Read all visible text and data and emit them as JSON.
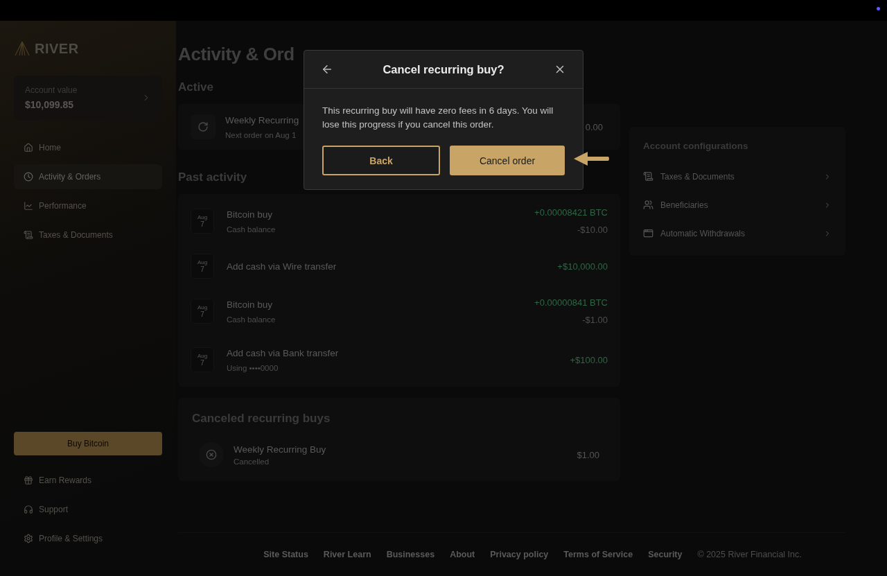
{
  "sidebar": {
    "logo": "RIVER",
    "account": {
      "label": "Account value",
      "value": "$10,099.85"
    },
    "nav": [
      {
        "label": "Home",
        "selected": false
      },
      {
        "label": "Activity & Orders",
        "selected": true
      },
      {
        "label": "Performance",
        "selected": false
      },
      {
        "label": "Taxes & Documents",
        "selected": false
      }
    ],
    "buy_button": "Buy Bitcoin",
    "bottom_nav": [
      {
        "label": "Earn Rewards"
      },
      {
        "label": "Support"
      },
      {
        "label": "Profile & Settings"
      }
    ]
  },
  "page_title": "Activity & Ord",
  "active": {
    "heading": "Active",
    "order": {
      "title": "Weekly Recurring",
      "subtitle": "Next order on Aug 1",
      "amount": "0.00"
    }
  },
  "past": {
    "heading": "Past activity",
    "rows": [
      {
        "month": "Aug",
        "day": "7",
        "title": "Bitcoin buy",
        "subtitle": "Cash balance",
        "amount": "+0.00008421 BTC",
        "amount_2": "-$10.00"
      },
      {
        "month": "Aug",
        "day": "7",
        "title": "Add cash via Wire transfer",
        "amount": "+$10,000.00"
      },
      {
        "month": "Aug",
        "day": "7",
        "title": "Bitcoin buy",
        "subtitle": "Cash balance",
        "amount": "+0.00000841 BTC",
        "amount_2": "-$1.00"
      },
      {
        "month": "Aug",
        "day": "7",
        "title": "Add cash via Bank transfer",
        "subtitle": "Using ••••0000",
        "amount": "+$100.00"
      }
    ]
  },
  "canceled": {
    "heading": "Canceled recurring buys",
    "item": {
      "title": "Weekly Recurring Buy",
      "status": "Cancelled",
      "amount": "$1.00"
    }
  },
  "account_configurations": {
    "title": "Account configurations",
    "items": [
      {
        "label": "Taxes & Documents"
      },
      {
        "label": "Beneficiaries"
      },
      {
        "label": "Automatic Withdrawals"
      }
    ]
  },
  "footer": {
    "links": [
      "Site Status",
      "River Learn",
      "Businesses",
      "About",
      "Privacy policy",
      "Terms of Service",
      "Security"
    ],
    "copyright": "© 2025 River Financial Inc."
  },
  "modal": {
    "title": "Cancel recurring buy?",
    "body": "This recurring buy will have zero fees in 6 days. You will lose this progress if you cancel this order.",
    "buttons": [
      {
        "label": "Back",
        "kind": "secondary"
      },
      {
        "label": "Cancel order",
        "kind": "primary"
      }
    ]
  }
}
